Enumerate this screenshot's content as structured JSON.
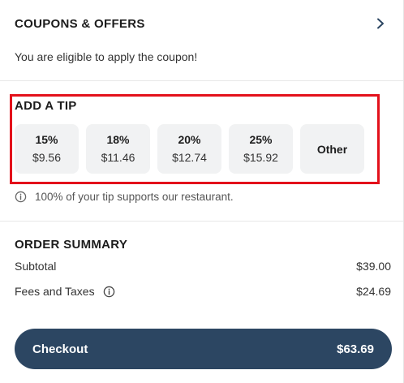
{
  "coupons": {
    "title": "COUPONS & OFFERS",
    "subtitle": "You are eligible to apply the coupon!",
    "chevron_icon": "chevron-right-icon"
  },
  "tip": {
    "title": "ADD A TIP",
    "options": [
      {
        "percent": "15%",
        "amount": "$9.56"
      },
      {
        "percent": "18%",
        "amount": "$11.46"
      },
      {
        "percent": "20%",
        "amount": "$12.74"
      },
      {
        "percent": "25%",
        "amount": "$15.92"
      }
    ],
    "other_label": "Other",
    "note": "100% of your tip supports our restaurant.",
    "highlight_color": "#e3111b"
  },
  "summary": {
    "title": "ORDER SUMMARY",
    "subtotal_label": "Subtotal",
    "subtotal_value": "$39.00",
    "fees_label": "Fees and Taxes",
    "fees_value": "$24.69"
  },
  "checkout": {
    "label": "Checkout",
    "total": "$63.69",
    "color": "#2c4662"
  }
}
